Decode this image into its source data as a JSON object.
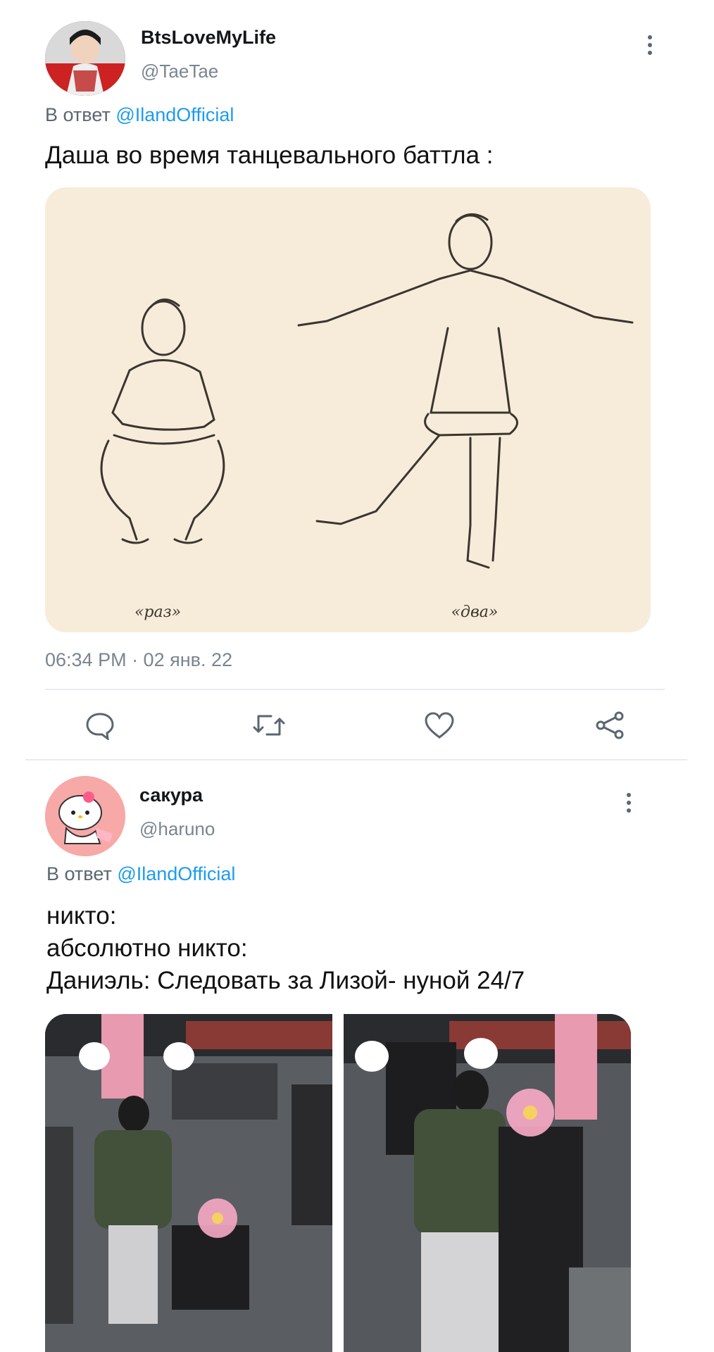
{
  "tweets": [
    {
      "display_name": "BtsLoveMyLife",
      "handle": "@TaeTae",
      "reply_prefix": "В ответ",
      "reply_mention": "@IlandOfficial",
      "text": "Даша во время танцевального баттла :",
      "image_captions": [
        "«раз»",
        "«два»"
      ],
      "timestamp": "06:34 PM · 02 янв. 22"
    },
    {
      "display_name": "сакура",
      "handle": "@haruno",
      "reply_prefix": "В ответ",
      "reply_mention": "@IlandOfficial",
      "text_lines": [
        "никто:",
        "абсолютно никто:",
        "Даниэль: Следовать за Лизой- нуной 24/7"
      ]
    }
  ],
  "actions": [
    "reply-icon",
    "retweet-icon",
    "like-icon",
    "share-icon"
  ],
  "colors": {
    "accent": "#1d9bf0",
    "muted": "#7a8590",
    "image_bg": "#f7ecd9"
  }
}
